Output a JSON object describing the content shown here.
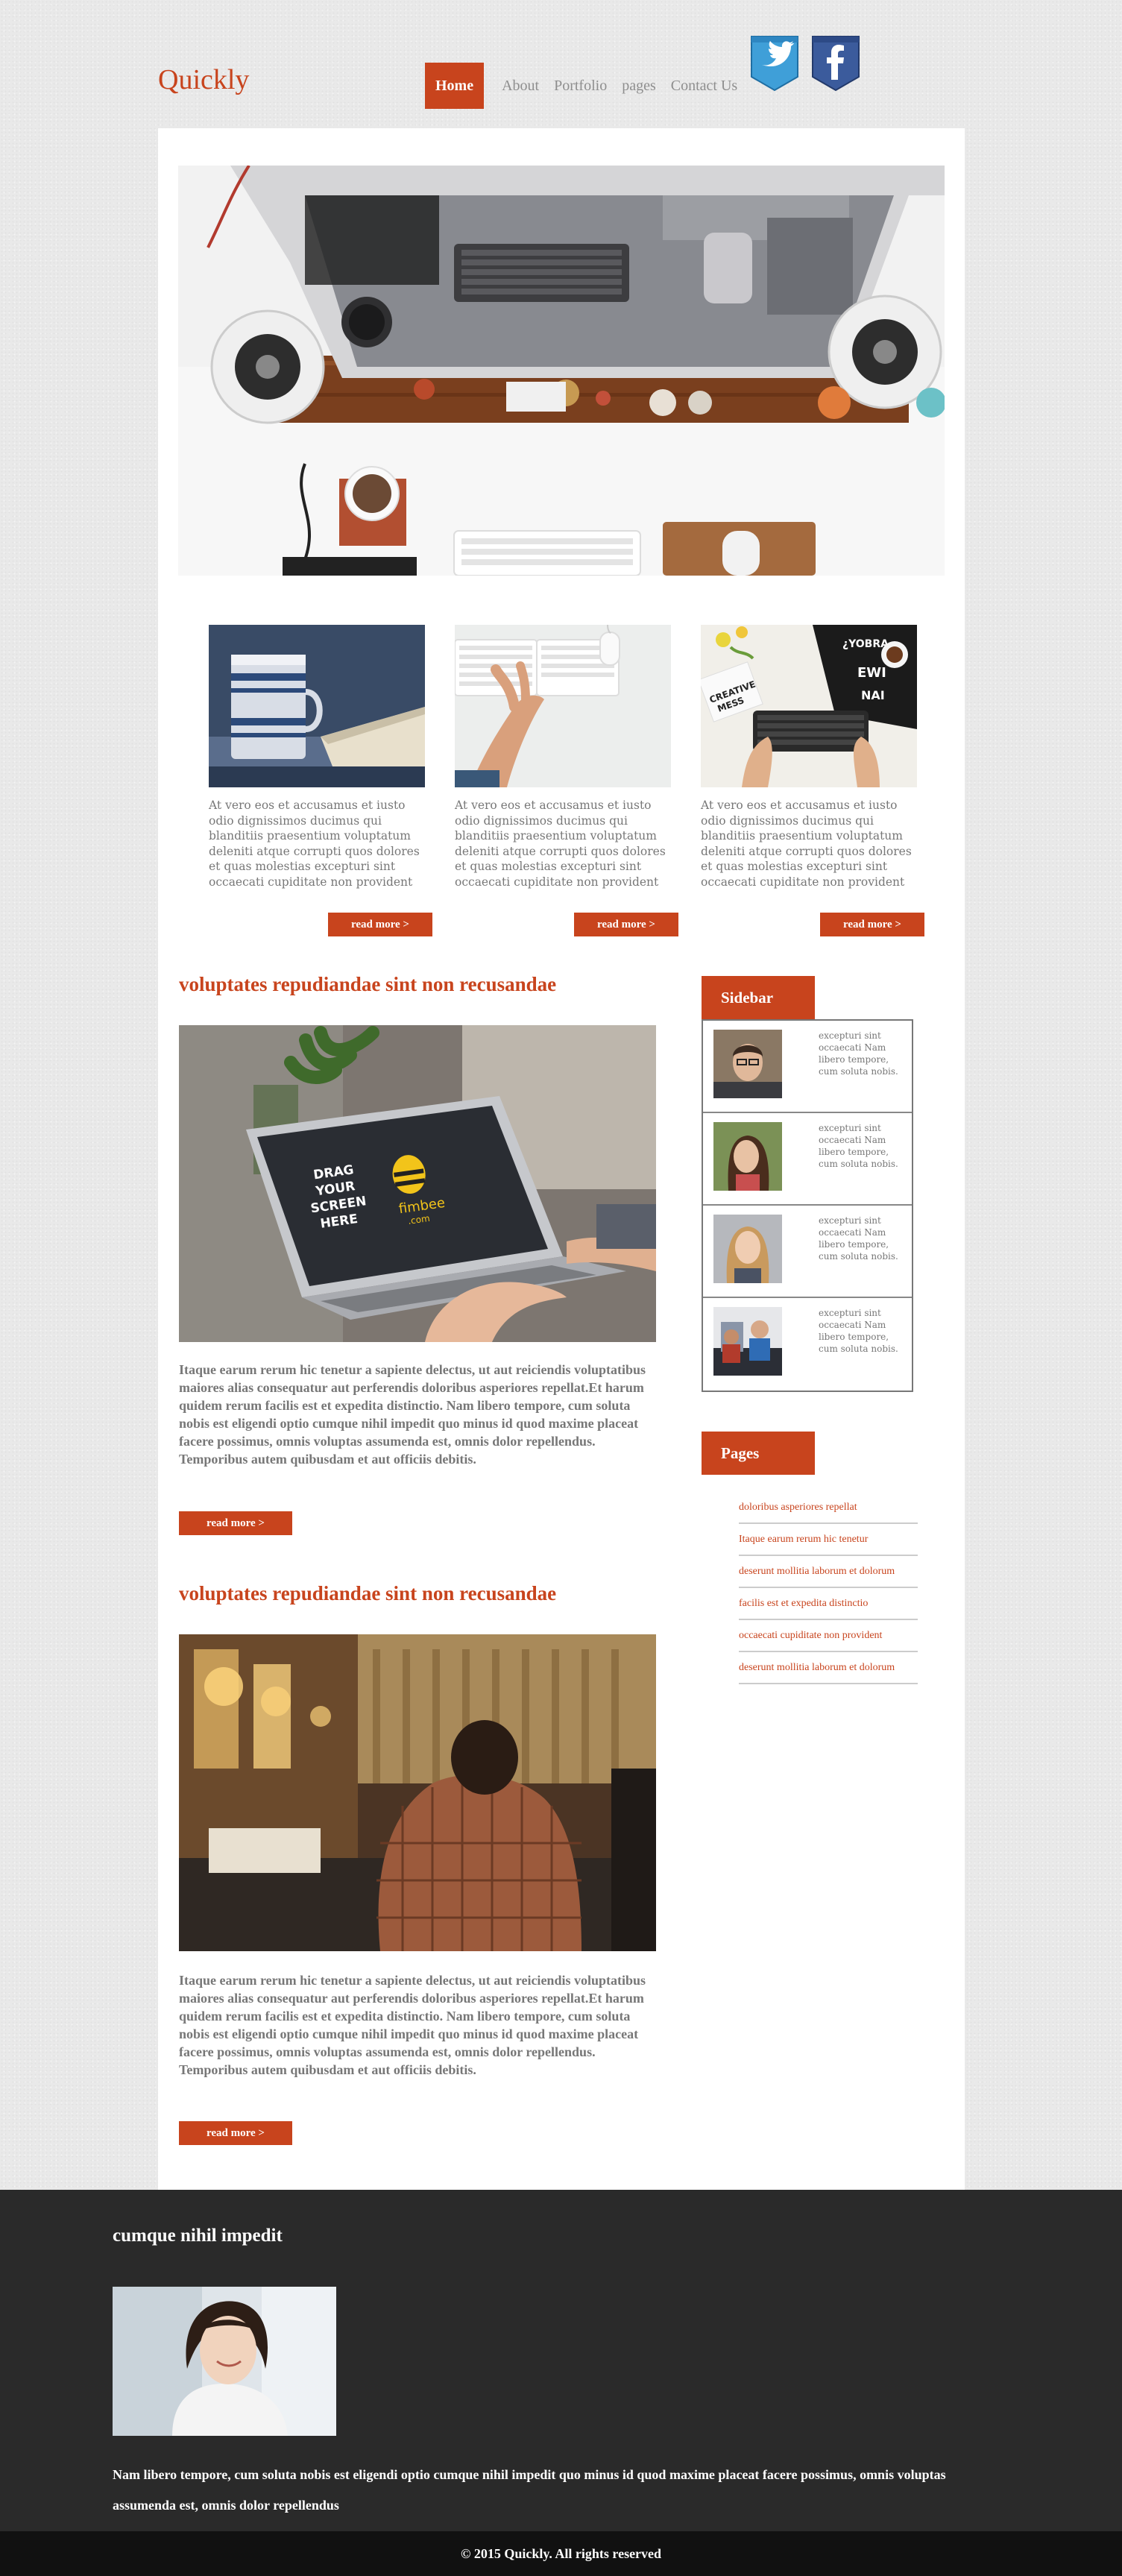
{
  "header": {
    "logo": "Quickly",
    "nav": [
      "Home",
      "About",
      "Portfolio",
      "pages",
      "Contact Us"
    ],
    "social": [
      "twitter-icon",
      "facebook-icon"
    ]
  },
  "colors": {
    "accent": "#c8441d",
    "footer_bg": "#2a2a2a",
    "bottom_bar": "#111111"
  },
  "cards": [
    {
      "text": "At vero eos et accusamus et iusto odio dignissimos ducimus qui blanditiis praesentium voluptatum deleniti atque corrupti quos dolores et quas molestias excepturi sint occaecati cupiditate non provident",
      "button": "read more >"
    },
    {
      "text": "At vero eos et accusamus et iusto odio dignissimos ducimus qui blanditiis praesentium voluptatum deleniti atque corrupti quos dolores et quas molestias excepturi sint occaecati cupiditate non provident",
      "button": "read more >"
    },
    {
      "text": "At vero eos et accusamus et iusto odio dignissimos ducimus qui blanditiis praesentium voluptatum deleniti atque corrupti quos dolores et quas molestias excepturi sint occaecati cupiditate non provident",
      "button": "read more >"
    }
  ],
  "posts": [
    {
      "title": "voluptates repudiandae sint non recusandae",
      "image_text": [
        "DRAG",
        "YOUR",
        "SCREEN",
        "HERE"
      ],
      "image_brand": "fimbee",
      "image_brand_sub": ".com",
      "text": "Itaque earum rerum hic tenetur a sapiente delectus, ut aut reiciendis voluptatibus maiores alias consequatur aut perferendis doloribus asperiores repellat.Et harum quidem rerum facilis est et expedita distinctio. Nam libero tempore, cum soluta nobis est eligendi optio cumque nihil impedit quo minus id quod maxime placeat facere possimus, omnis voluptas assumenda est, omnis dolor repellendus. Temporibus autem quibusdam et aut officiis debitis.",
      "button": "read more >"
    },
    {
      "title": "voluptates repudiandae sint non recusandae",
      "text": "Itaque earum rerum hic tenetur a sapiente delectus, ut aut reiciendis voluptatibus maiores alias consequatur aut perferendis doloribus asperiores repellat.Et harum quidem rerum facilis est et expedita distinctio. Nam libero tempore, cum soluta nobis est eligendi optio cumque nihil impedit quo minus id quod maxime placeat facere possimus, omnis voluptas assumenda est, omnis dolor repellendus. Temporibus autem quibusdam et aut officiis debitis.",
      "button": "read more >"
    }
  ],
  "sidebar": {
    "title": "Sidebar",
    "items": [
      {
        "text": "excepturi sint occaecati Nam libero tempore, cum soluta nobis."
      },
      {
        "text": "excepturi sint occaecati Nam libero tempore, cum soluta nobis."
      },
      {
        "text": "excepturi sint occaecati Nam libero tempore, cum soluta nobis."
      },
      {
        "text": "excepturi sint occaecati Nam libero tempore, cum soluta nobis."
      }
    ]
  },
  "pages": {
    "title": "Pages",
    "links": [
      "doloribus asperiores repellat",
      "Itaque earum rerum hic tenetur",
      "deserunt mollitia laborum et dolorum",
      "facilis est et expedita distinctio",
      "occaecati cupiditate non provident",
      "deserunt mollitia laborum et dolorum"
    ]
  },
  "footer": {
    "title": "cumque nihil impedit",
    "text": "Nam libero tempore, cum soluta nobis est eligendi optio cumque nihil impedit quo minus id quod maxime placeat facere possimus, omnis voluptas assumenda est, omnis dolor repellendus",
    "copyright": "© 2015 Quickly. All rights reserved"
  }
}
